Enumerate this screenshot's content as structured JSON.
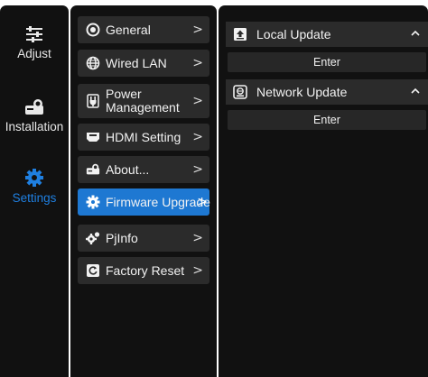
{
  "nav": [
    {
      "label": "Adjust",
      "icon": "sliders-icon"
    },
    {
      "label": "Installation",
      "icon": "projector-icon"
    },
    {
      "label": "Settings",
      "icon": "gear-icon",
      "active": true
    }
  ],
  "menu": [
    {
      "label": "General",
      "icon": "record-icon"
    },
    {
      "label": "Wired LAN",
      "icon": "globe-icon"
    },
    {
      "label_line1": "Power",
      "label_line2": "Management",
      "icon": "plug-icon"
    },
    {
      "label": "HDMI Setting",
      "icon": "hdmi-icon"
    },
    {
      "label": "About...",
      "icon": "projector-icon"
    },
    {
      "label": "Firmware Upgrade",
      "icon": "gear-icon",
      "active": true
    },
    {
      "label": "PjInfo",
      "icon": "gears-icon"
    },
    {
      "label": "Factory Reset",
      "icon": "reset-icon"
    }
  ],
  "chevron": ">",
  "detail": {
    "local_update": {
      "title": "Local Update",
      "button": "Enter",
      "icon": "upload-icon"
    },
    "network_update": {
      "title": "Network Update",
      "button": "Enter",
      "icon": "network-icon"
    }
  },
  "colors": {
    "accent": "#1e78d2",
    "panel": "#111111",
    "item": "#2b2b2b"
  }
}
